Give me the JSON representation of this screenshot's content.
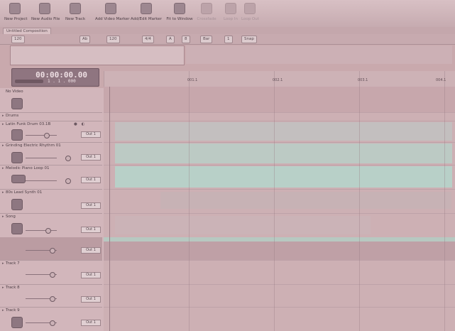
{
  "toolbar": {
    "buttons": [
      {
        "label": "New Project",
        "dim": false
      },
      {
        "label": "New Audio File",
        "dim": false
      },
      {
        "label": "New Track",
        "dim": false
      },
      {
        "label": "Add Video Marker",
        "dim": false
      },
      {
        "label": "Add/Edit Marker",
        "dim": false
      },
      {
        "label": "Fit to Window",
        "dim": false
      },
      {
        "label": "Crossfade",
        "dim": true
      },
      {
        "label": "Loop In",
        "dim": true
      },
      {
        "label": "Loop Out",
        "dim": true
      }
    ]
  },
  "tabs": {
    "active": "Untitled Composition"
  },
  "controls": [
    "120",
    "Ab",
    "120",
    "4/4",
    "A",
    "8",
    "Bar",
    "1",
    "Snap"
  ],
  "transport": {
    "timecode": "00:00:00.00",
    "beats": "1 . 1 . 000"
  },
  "tracks": {
    "video_label": "No Video",
    "items": [
      {
        "name": "Drums",
        "plugin": ""
      },
      {
        "name": "Latin Funk Drum 03.1B",
        "plugin": "Out 1"
      },
      {
        "name": "Grinding Electric Rhythm 01",
        "plugin": "Out 1"
      },
      {
        "name": "Melodic Piano Loop 01",
        "plugin": "Out 1"
      },
      {
        "name": "80s Lead Synth 01",
        "plugin": "Out 1"
      },
      {
        "name": "Song",
        "plugin": "Out 1"
      },
      {
        "name": "",
        "plugin": "Out 1"
      },
      {
        "name": "Track 7",
        "plugin": "Out 1"
      },
      {
        "name": "Track 8",
        "plugin": "Out 1"
      },
      {
        "name": "Track 9",
        "plugin": "Out 1"
      }
    ]
  },
  "ruler": {
    "labels": [
      "001.1",
      "002.1",
      "003.1",
      "004.1"
    ]
  },
  "colors": {
    "region": "#b8d0c8",
    "region_dark": "#9fb7b0",
    "accent": "#8f7580"
  }
}
